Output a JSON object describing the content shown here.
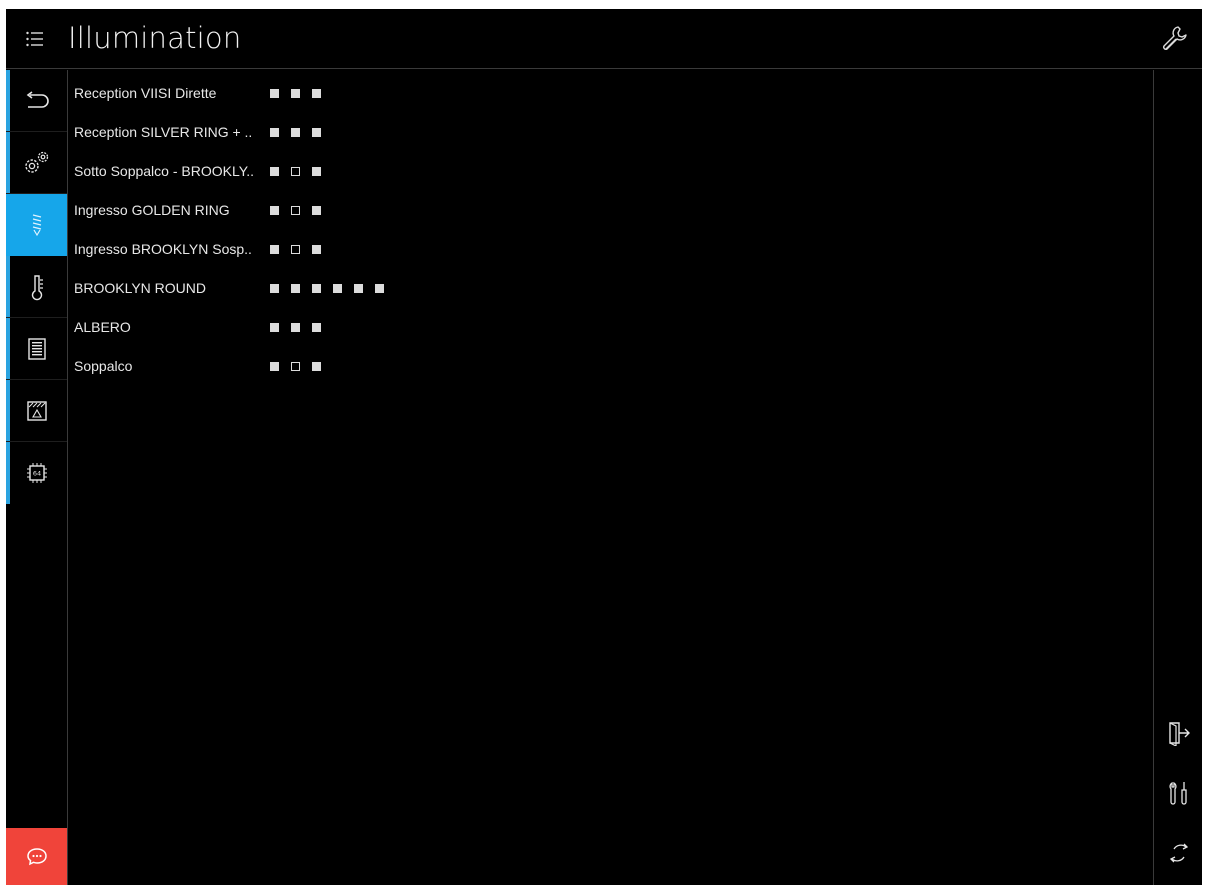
{
  "header": {
    "title": "Illumination",
    "menu_icon": "list-menu-icon",
    "settings_icon": "wrench-icon"
  },
  "sidebar": {
    "accent": "#16a6ea",
    "items": [
      {
        "name": "back",
        "icon": "back-arrow-icon"
      },
      {
        "name": "settings",
        "icon": "gears-icon"
      },
      {
        "name": "illumination",
        "icon": "lightbulb-icon",
        "active": true
      },
      {
        "name": "temperature",
        "icon": "thermometer-icon"
      },
      {
        "name": "keypad",
        "icon": "keypad-icon"
      },
      {
        "name": "alarm",
        "icon": "alarm-panel-icon"
      },
      {
        "name": "processor",
        "icon": "chip-64-icon",
        "chip_label": "64"
      }
    ],
    "chat": {
      "icon": "chat-bubble-icon",
      "color": "#f0443a"
    }
  },
  "rightbar": {
    "icons": [
      "exit-door-icon",
      "tools-icon",
      "refresh-icon"
    ]
  },
  "rows": [
    {
      "label": "Reception VIISI Dirette",
      "states": [
        1,
        1,
        1
      ]
    },
    {
      "label": "Reception SILVER RING + ..",
      "states": [
        1,
        1,
        1
      ]
    },
    {
      "label": "Sotto Soppalco - BROOKLY..",
      "states": [
        1,
        0,
        1
      ]
    },
    {
      "label": "Ingresso GOLDEN RING",
      "states": [
        1,
        0,
        1
      ]
    },
    {
      "label": "Ingresso BROOKLYN Sosp..",
      "states": [
        1,
        0,
        1
      ]
    },
    {
      "label": "BROOKLYN ROUND",
      "states": [
        1,
        1,
        1,
        1,
        1,
        1
      ]
    },
    {
      "label": "ALBERO",
      "states": [
        1,
        1,
        1
      ]
    },
    {
      "label": "Soppalco",
      "states": [
        1,
        0,
        1
      ]
    }
  ]
}
